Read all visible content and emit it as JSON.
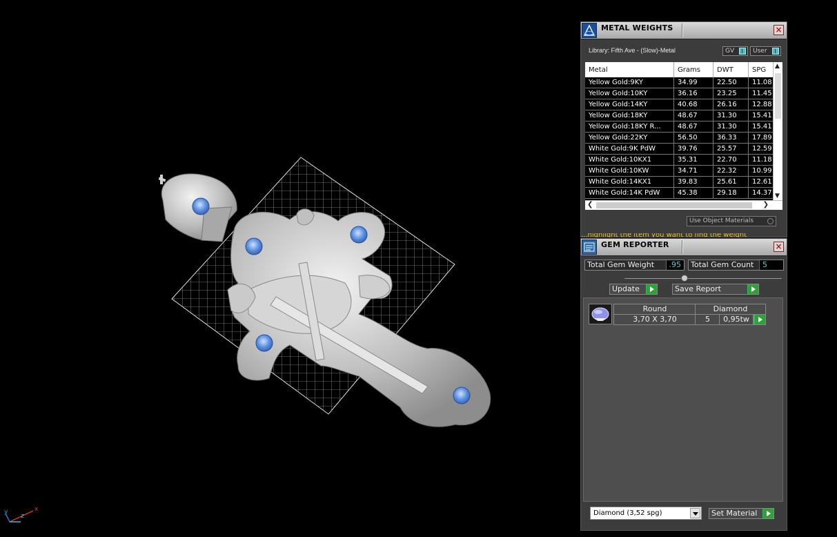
{
  "metal_weights": {
    "title": "METAL WEIGHTS",
    "close": "×",
    "library_label": "Library: Fifth Ave - (Slow)-Metal",
    "toggle_gv": "GV",
    "toggle_user": "User",
    "columns": [
      "Metal",
      "Grams",
      "DWT",
      "SPG"
    ],
    "rows": [
      [
        "Yellow Gold:9KY",
        "34.99",
        "22.50",
        "11.08"
      ],
      [
        "Yellow Gold:10KY",
        "36.16",
        "23.25",
        "11.45"
      ],
      [
        "Yellow Gold:14KY",
        "40.68",
        "26.16",
        "12.88"
      ],
      [
        "Yellow Gold:18KY",
        "48.67",
        "31.30",
        "15.41"
      ],
      [
        "Yellow Gold:18KY R...",
        "48.67",
        "31.30",
        "15.41"
      ],
      [
        "Yellow Gold:22KY",
        "56.50",
        "36.33",
        "17.89"
      ],
      [
        "White Gold:9K PdW",
        "39.76",
        "25.57",
        "12.59"
      ],
      [
        "White Gold:10KX1",
        "35.31",
        "22.70",
        "11.18"
      ],
      [
        "White Gold:10KW",
        "34.71",
        "22.32",
        "10.99"
      ],
      [
        "White Gold:14KX1",
        "39.83",
        "25.61",
        "12.61"
      ],
      [
        "White Gold:14K PdW",
        "45.38",
        "29.18",
        "14.37"
      ]
    ],
    "use_object_materials": "Use Object Materials",
    "hint_text": "...highlight the item you want to find the weight"
  },
  "gem_reporter": {
    "title": "GEM REPORTER",
    "close": "×",
    "total_gem_weight_label": "Total Gem Weight",
    "total_gem_weight_value": ".95",
    "total_gem_count_label": "Total Gem Count",
    "total_gem_count_value": "5",
    "update_label": "Update",
    "save_report_label": "Save Report",
    "gem": {
      "shape": "Round",
      "material": "Diamond",
      "size": "3,70 X 3,70",
      "count": "5",
      "weight": "0,95tw"
    },
    "material_select": "Diamond    (3,52 spg)",
    "set_material_label": "Set Material"
  },
  "viewport": {
    "axis_labels": [
      "y",
      "z",
      "x"
    ],
    "gem_color": "#5a8fe0"
  }
}
